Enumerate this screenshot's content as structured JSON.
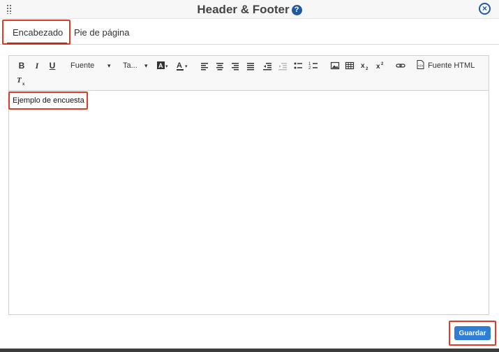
{
  "dialog": {
    "title": "Header & Footer",
    "help_glyph": "?",
    "close_glyph": "×"
  },
  "tabs": [
    {
      "label": "Encabezado",
      "active": true
    },
    {
      "label": "Pie de página",
      "active": false
    }
  ],
  "toolbar": {
    "bold": "B",
    "italic": "I",
    "underline": "U",
    "font_label": "Fuente",
    "size_label": "Ta...",
    "dropdown_arrow": "▾",
    "html_source_label": "Fuente HTML",
    "icons": [
      "bold-icon",
      "italic-icon",
      "underline-icon",
      "text-background-color-icon",
      "text-color-icon",
      "align-left-icon",
      "align-center-icon",
      "align-right-icon",
      "align-justify-icon",
      "outdent-icon",
      "indent-icon",
      "bulleted-list-icon",
      "numbered-list-icon",
      "image-icon",
      "table-icon",
      "subscript-icon",
      "superscript-icon",
      "link-icon",
      "html-source-icon",
      "remove-format-icon"
    ]
  },
  "editor": {
    "content": "Ejemplo de encuesta"
  },
  "footer": {
    "save_label": "Guardar"
  },
  "colors": {
    "accent": "#2e7ed6",
    "highlight_box": "#e03a24",
    "title_icon": "#1f5aa6"
  }
}
